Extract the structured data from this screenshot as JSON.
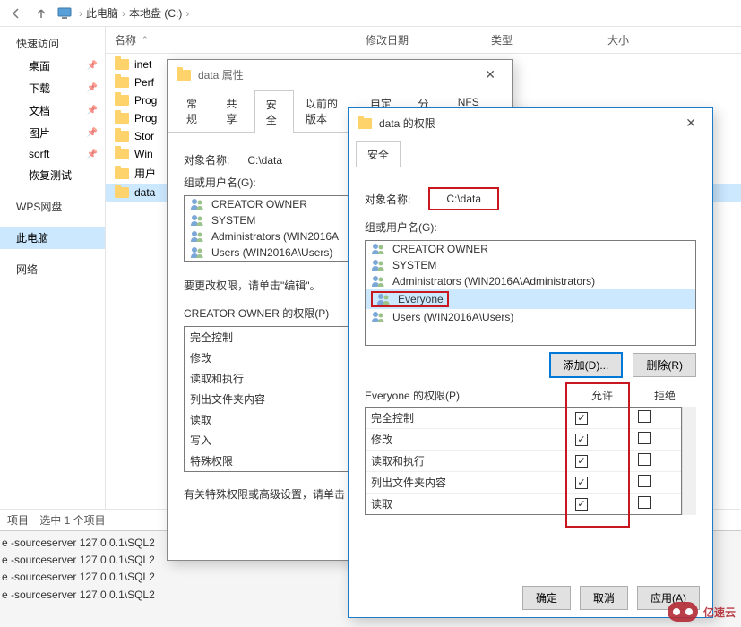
{
  "breadcrumb": {
    "this_pc": "此电脑",
    "drive": "本地盘 (C:)"
  },
  "sidebar": {
    "quick_access": "快速访问",
    "items": [
      {
        "label": "桌面"
      },
      {
        "label": "下载"
      },
      {
        "label": "文档"
      },
      {
        "label": "图片"
      },
      {
        "label": "sorft"
      },
      {
        "label": "恢复测试"
      }
    ],
    "wps": "WPS网盘",
    "this_pc": "此电脑",
    "network": "网络"
  },
  "columns": {
    "name": "名称",
    "date": "修改日期",
    "type": "类型",
    "size": "大小"
  },
  "files": [
    {
      "name": "inet"
    },
    {
      "name": "Perf"
    },
    {
      "name": "Prog"
    },
    {
      "name": "Prog"
    },
    {
      "name": "Stor"
    },
    {
      "name": "Win"
    },
    {
      "name": "用户"
    },
    {
      "name": "data",
      "selected": true
    }
  ],
  "statusbar": {
    "items": "项目",
    "selected": "选中 1 个项目"
  },
  "terminal": [
    "e -sourceserver 127.0.0.1\\SQL2",
    "e -sourceserver 127.0.0.1\\SQL2",
    "e -sourceserver 127.0.0.1\\SQL2",
    "e -sourceserver 127.0.0.1\\SQL2"
  ],
  "dlg1": {
    "title": "data 属性",
    "tabs": [
      "常规",
      "共享",
      "安全",
      "以前的版本",
      "自定义",
      "分类",
      "NFS 共享"
    ],
    "active_tab": 2,
    "object_label": "对象名称:",
    "object_value": "C:\\data",
    "group_label": "组或用户名(G):",
    "principals": [
      "CREATOR OWNER",
      "SYSTEM",
      "Administrators (WIN2016A",
      "Users (WIN2016A\\Users)"
    ],
    "edit_hint": "要更改权限，请单击\"编辑\"。",
    "perm_title": "CREATOR OWNER 的权限(P)",
    "perms": [
      "完全控制",
      "修改",
      "读取和执行",
      "列出文件夹内容",
      "读取",
      "写入",
      "特殊权限"
    ],
    "advanced_hint": "有关特殊权限或高级设置，请单击"
  },
  "dlg2": {
    "title": "data 的权限",
    "tab": "安全",
    "object_label": "对象名称:",
    "object_value": "C:\\data",
    "group_label": "组或用户名(G):",
    "principals": [
      "CREATOR OWNER",
      "SYSTEM",
      "Administrators (WIN2016A\\Administrators)",
      "Everyone",
      "Users (WIN2016A\\Users)"
    ],
    "selected_principal": 3,
    "add_btn": "添加(D)...",
    "remove_btn": "删除(R)",
    "perm_title": "Everyone 的权限(P)",
    "allow": "允许",
    "deny": "拒绝",
    "perms": [
      {
        "name": "完全控制",
        "allow": true,
        "deny": false
      },
      {
        "name": "修改",
        "allow": true,
        "deny": false
      },
      {
        "name": "读取和执行",
        "allow": true,
        "deny": false
      },
      {
        "name": "列出文件夹内容",
        "allow": true,
        "deny": false
      },
      {
        "name": "读取",
        "allow": true,
        "deny": false
      }
    ],
    "ok": "确定",
    "cancel": "取消",
    "apply": "应用(A)"
  },
  "watermark": "亿速云"
}
